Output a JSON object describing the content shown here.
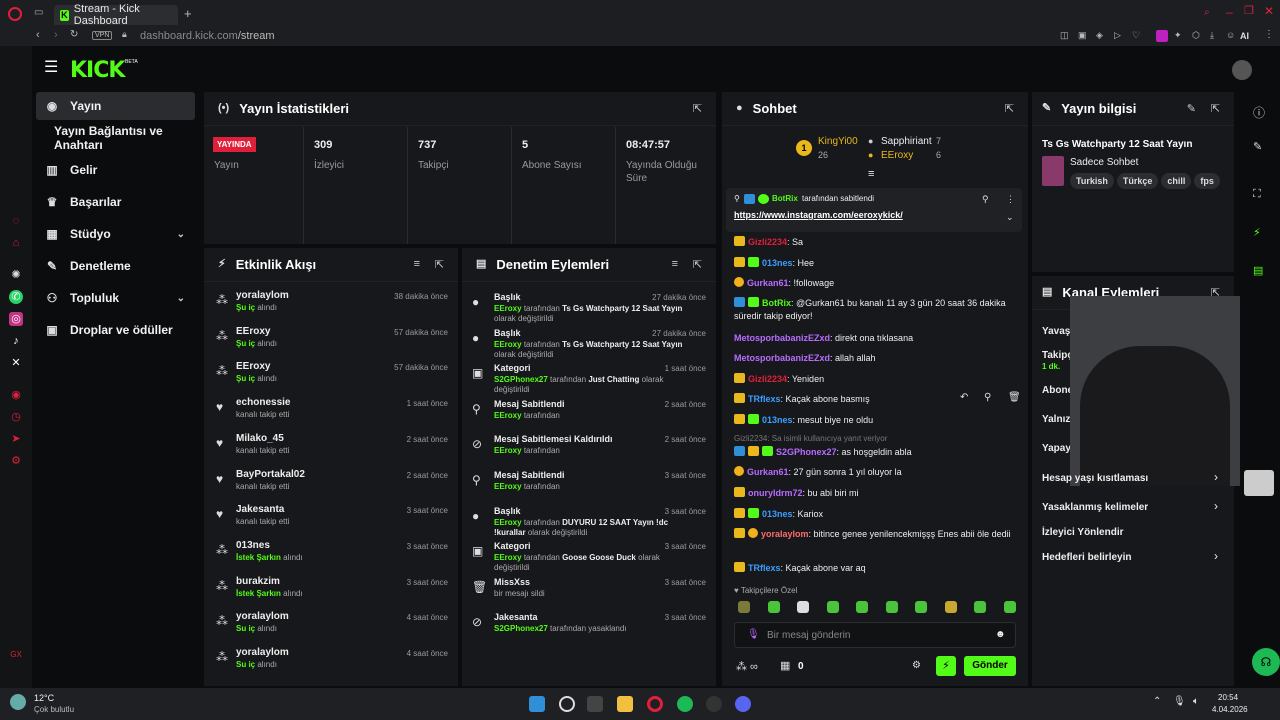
{
  "browser": {
    "tab_title": "Stream - Kick Dashboard",
    "url_host": "dashboard.kick.com",
    "url_path": "/stream",
    "vpn_label": "VPN",
    "ai_label": "AI"
  },
  "header": {
    "logo": "KICK",
    "beta": "BETA"
  },
  "sidebar": {
    "items": [
      {
        "label": "Yayın",
        "icon": "broadcast-icon"
      },
      {
        "label": "Yayın Bağlantısı ve Anahtarı"
      },
      {
        "label": "Gelir",
        "icon": "chart-icon"
      },
      {
        "label": "Başarılar",
        "icon": "trophy-icon"
      },
      {
        "label": "Stüdyo",
        "icon": "grid-icon"
      },
      {
        "label": "Denetleme",
        "icon": "wrench-icon"
      },
      {
        "label": "Topluluk",
        "icon": "people-icon"
      },
      {
        "label": "Droplar ve ödüller",
        "icon": "gift-icon"
      }
    ]
  },
  "stats": {
    "title": "Yayın İstatistikleri",
    "live_badge": "YAYINDA",
    "items": [
      {
        "value": "",
        "label": "Yayın"
      },
      {
        "value": "309",
        "label": "İzleyici"
      },
      {
        "value": "737",
        "label": "Takipçi"
      },
      {
        "value": "5",
        "label": "Abone Sayısı"
      },
      {
        "value": "08:47:57",
        "label": "Yayında Olduğu Süre"
      }
    ]
  },
  "activity": {
    "title": "Etkinlik Akışı",
    "rows": [
      {
        "name": "yoralaylom",
        "action": "Şu iç",
        "suffix": "alındı",
        "time": "38 dakika önce",
        "icon": "drop-icon"
      },
      {
        "name": "EEroxy",
        "action": "Şu iç",
        "suffix": "alındı",
        "time": "57 dakika önce",
        "icon": "drop-icon"
      },
      {
        "name": "EEroxy",
        "action": "Şu iç",
        "suffix": "alındı",
        "time": "57 dakika önce",
        "icon": "drop-icon"
      },
      {
        "name": "echonessie",
        "action": "",
        "suffix": "kanalı takip etti",
        "time": "1 saat önce",
        "icon": "heart-icon"
      },
      {
        "name": "Milako_45",
        "action": "",
        "suffix": "kanalı takip etti",
        "time": "2 saat önce",
        "icon": "heart-icon"
      },
      {
        "name": "BayPortakal02",
        "action": "",
        "suffix": "kanalı takip etti",
        "time": "2 saat önce",
        "icon": "heart-icon"
      },
      {
        "name": "Jakesanta",
        "action": "",
        "suffix": "kanalı takip etti",
        "time": "3 saat önce",
        "icon": "heart-icon"
      },
      {
        "name": "013nes",
        "action": "İstek Şarkın",
        "suffix": "alındı",
        "time": "3 saat önce",
        "icon": "drop-icon"
      },
      {
        "name": "burakzim",
        "action": "İstek Şarkın",
        "suffix": "alındı",
        "time": "3 saat önce",
        "icon": "drop-icon"
      },
      {
        "name": "yoralaylom",
        "action": "Su iç",
        "suffix": "alındı",
        "time": "4 saat önce",
        "icon": "drop-icon"
      },
      {
        "name": "yoralaylom",
        "action": "Su iç",
        "suffix": "alındı",
        "time": "4 saat önce",
        "icon": "drop-icon"
      }
    ]
  },
  "moderation": {
    "title": "Denetim Eylemleri",
    "rows": [
      {
        "title": "Başlık",
        "user": "EEroxy",
        "by": "tarafından",
        "detail": "Ts Gs Watchparty 12 Saat Yayın",
        "tail": "olarak değiştirildi",
        "time": "27 dakika önce"
      },
      {
        "title": "Başlık",
        "user": "EEroxy",
        "by": "tarafından",
        "detail": "Ts Gs Watchparty 12 Saat Yayın",
        "tail": "olarak değiştirildi",
        "time": "27 dakika önce"
      },
      {
        "title": "Kategori",
        "user": "S2GPhonex27",
        "by": "tarafından",
        "detail": "Just Chatting",
        "tail": "olarak değiştirildi",
        "time": "1 saat önce"
      },
      {
        "title": "Mesaj Sabitlendi",
        "user": "EEroxy",
        "by": "tarafından",
        "detail": "",
        "tail": "",
        "time": "2 saat önce"
      },
      {
        "title": "Mesaj Sabitlemesi Kaldırıldı",
        "user": "EEroxy",
        "by": "tarafından",
        "detail": "",
        "tail": "",
        "time": "2 saat önce"
      },
      {
        "title": "Mesaj Sabitlendi",
        "user": "EEroxy",
        "by": "tarafından",
        "detail": "",
        "tail": "",
        "time": "3 saat önce"
      },
      {
        "title": "Başlık",
        "user": "EEroxy",
        "by": "tarafından",
        "detail": "DUYURU 12 SAAT Yayın !dc !kurallar",
        "tail": "olarak değiştirildi",
        "time": "3 saat önce"
      },
      {
        "title": "Kategori",
        "user": "EEroxy",
        "by": "tarafından",
        "detail": "Goose Goose Duck",
        "tail": "olarak değiştirildi",
        "time": "3 saat önce"
      },
      {
        "title": "MissXss",
        "user": "",
        "by": "bir mesajı sildi",
        "detail": "",
        "tail": "",
        "time": "3 saat önce"
      },
      {
        "title": "Jakesanta",
        "user": "S2GPhonex27",
        "by": "tarafından yasaklandı",
        "detail": "",
        "tail": "",
        "time": "3 saat önce"
      }
    ]
  },
  "chat": {
    "title": "Sohbet",
    "leaders": [
      {
        "rank": "1",
        "name": "KingYi00",
        "count": "26"
      },
      {
        "name": "Sapphiriant",
        "count": "7"
      },
      {
        "name": "EEroxy",
        "count": "6"
      }
    ],
    "pinned": {
      "user": "BotRix",
      "by": "tarafından sabitlendi",
      "link": "https://www.instagram.com/eeroxykick/"
    },
    "messages": [
      {
        "user": "Gizli2234",
        "color": "#e0203a",
        "badges": [
          "crown"
        ],
        "text": "Sa"
      },
      {
        "user": "013nes",
        "color": "#3aa0ff",
        "badges": [
          "crown",
          "sub"
        ],
        "text": "Hee"
      },
      {
        "user": "Gurkan61",
        "color": "#b86cff",
        "badges": [
          "num"
        ],
        "text": "!followage"
      },
      {
        "user": "BotRix",
        "color": "#53fc18",
        "badges": [
          "mod",
          "sub"
        ],
        "text": "@Gurkan61 bu kanalı 11 ay 3 gün 20 saat 36 dakika süredir takip ediyor!"
      },
      {
        "user": "MetosporbabanizEZxd",
        "color": "#b86cff",
        "badges": [],
        "text": "direkt ona tıklasana"
      },
      {
        "user": "MetosporbabanizEZxd",
        "color": "#b86cff",
        "badges": [],
        "text": "allah allah"
      },
      {
        "user": "Gizli2234",
        "color": "#e0203a",
        "badges": [
          "crown"
        ],
        "text": "Yeniden"
      },
      {
        "user": "TRflexs",
        "color": "#3aa0ff",
        "badges": [
          "crown"
        ],
        "text": "Kaçak abone basmış"
      },
      {
        "user": "013nes",
        "color": "#3aa0ff",
        "badges": [
          "crown",
          "sub"
        ],
        "text": "mesut biye ne oldu"
      },
      {
        "user": "S2GPhonex27",
        "color": "#b86cff",
        "badges": [
          "mod",
          "crown",
          "sub"
        ],
        "text": "as hoşgeldin abla"
      },
      {
        "user": "Gurkan61",
        "color": "#b86cff",
        "badges": [
          "num"
        ],
        "text": "27 gün sonra 1 yıl oluyor la"
      },
      {
        "user": "onuryldrm72",
        "color": "#b86cff",
        "badges": [
          "crown"
        ],
        "text": "bu abi biri mi"
      },
      {
        "user": "013nes",
        "color": "#3aa0ff",
        "badges": [
          "crown",
          "sub"
        ],
        "text": "Kariox"
      },
      {
        "user": "yoralaylom",
        "color": "#ff6b6b",
        "badges": [
          "crown",
          "num"
        ],
        "text": "bitince genee yenilencekmişşş Enes abii öle dedii"
      },
      {
        "user": "TRflexs",
        "color": "#3aa0ff",
        "badges": [
          "crown"
        ],
        "text": "Kaçak abone var aq"
      }
    ],
    "reply_hint": "Gizli2234: Sa isimli kullanıcıya yanıt veriyor",
    "followers_only": "Takipçilere Özel",
    "input_placeholder": "Bir mesaj gönderin",
    "points": "0",
    "send_label": "Gönder"
  },
  "stream_info": {
    "title": "Yayın bilgisi",
    "stream_title": "Ts Gs Watchparty 12 Saat Yayın",
    "category": "Sadece Sohbet",
    "tags": [
      "Turkish",
      "Türkçe",
      "chill",
      "fps"
    ]
  },
  "channel_actions": {
    "title": "Kanal Eylemleri",
    "partial": [
      "Yavaş",
      "Takipç",
      "Abone",
      "Yalnız",
      "Yapay"
    ],
    "follow_time": "1 dk.",
    "rows": [
      "Hesap yaşı kısıtlaması",
      "Yasaklanmış kelimeler",
      "İzleyici Yönlendir",
      "Hedefleri belirleyin"
    ]
  },
  "taskbar": {
    "weather_temp": "12°C",
    "weather_text": "Çok bulutlu",
    "time": "20:54",
    "date": "4.04.2026"
  },
  "colors": {
    "accent": "#53fc18",
    "live": "#e0203a",
    "panel": "#17181b"
  }
}
